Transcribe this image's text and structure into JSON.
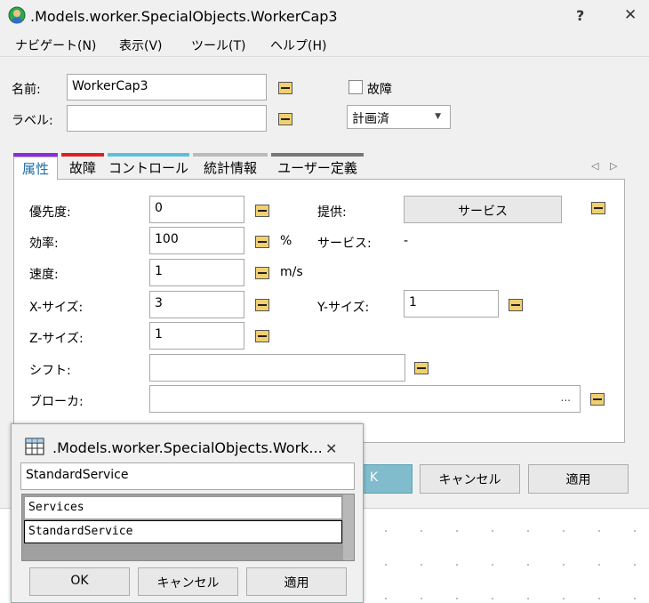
{
  "window": {
    "title": ".Models.worker.SpecialObjects.WorkerCap3",
    "help_label": "?",
    "close_label": "✕"
  },
  "menu": {
    "items": [
      "ナビゲート(N)",
      "表示(V)",
      "ツール(T)",
      "ヘルプ(H)"
    ]
  },
  "header": {
    "name_label": "名前:",
    "name_value": "WorkerCap3",
    "label_label": "ラベル:",
    "label_value": "",
    "failure_label": "故障",
    "failure_checked": false,
    "status_value": "計画済",
    "status_arrow": "▼"
  },
  "tabs": [
    {
      "label": "属性",
      "color": "#8a2be2",
      "active": true
    },
    {
      "label": "故障",
      "color": "#e02020",
      "active": false
    },
    {
      "label": "コントロール",
      "color": "#5bc0de",
      "active": false
    },
    {
      "label": "統計情報",
      "color": "#bbbbbb",
      "active": false
    },
    {
      "label": "ユーザー定義",
      "color": "#777777",
      "active": false
    }
  ],
  "tab_nav": {
    "left": "◁",
    "right": "▷"
  },
  "attributes": {
    "priority_label": "優先度:",
    "priority_value": "0",
    "efficiency_label": "効率:",
    "efficiency_value": "100",
    "efficiency_unit": "%",
    "speed_label": "速度:",
    "speed_value": "1",
    "speed_unit": "m/s",
    "xsize_label": "X-サイズ:",
    "xsize_value": "3",
    "ysize_label": "Y-サイズ:",
    "ysize_value": "1",
    "zsize_label": "Z-サイズ:",
    "zsize_value": "1",
    "shift_label": "シフト:",
    "shift_value": "",
    "broker_label": "ブローカ:",
    "broker_value": "",
    "broker_ellipsis": "...",
    "provide_label": "提供:",
    "provide_button": "サービス",
    "service_label": "サービス:",
    "service_value": "-"
  },
  "buttons": {
    "ok": "K",
    "cancel": "キャンセル",
    "apply": "適用"
  },
  "popup": {
    "title": ".Models.worker.SpecialObjects.Work...",
    "close_label": "✕",
    "input_value": "StandardService",
    "list_items": [
      "Services",
      "StandardService"
    ],
    "selected_index": 1,
    "ok": "OK",
    "cancel": "キャンセル",
    "apply": "適用"
  }
}
